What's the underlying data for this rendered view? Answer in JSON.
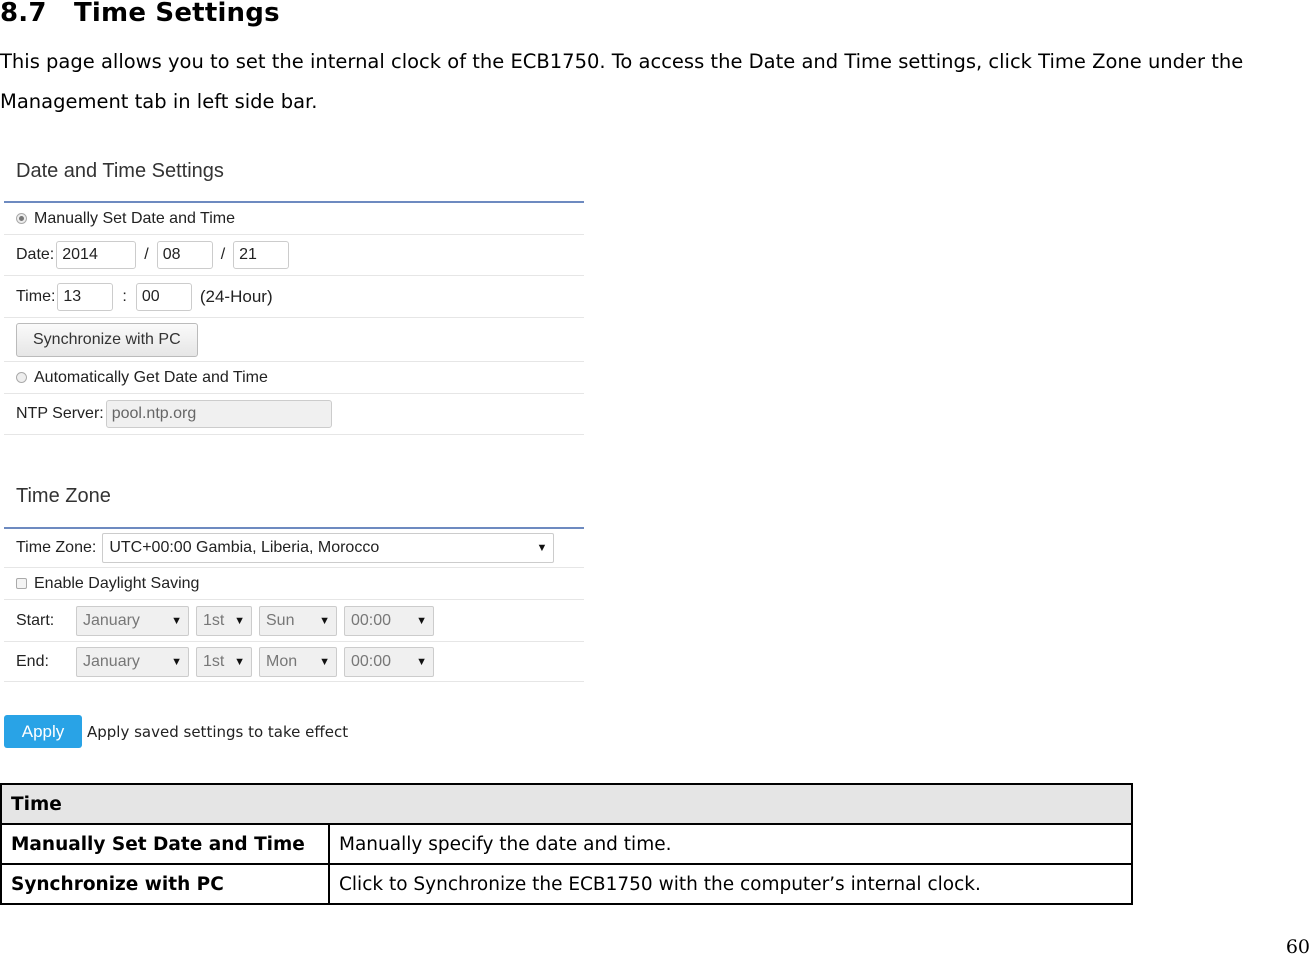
{
  "heading": {
    "number": "8.7",
    "title": "Time Settings"
  },
  "intro": "This page allows you to set the internal clock of the ECB1750. To access the Date and Time settings, click Time Zone under the Management tab in left side bar.",
  "screenshot": {
    "date_time_section": {
      "title": "Date and Time Settings",
      "manual_label": "Manually Set Date and Time",
      "manual_selected": true,
      "date_label": "Date:",
      "date_year": "2014",
      "date_month": "08",
      "date_day": "21",
      "date_sep": "/",
      "time_label": "Time:",
      "time_hour": "13",
      "time_minute": "00",
      "time_sep": ":",
      "time_format": "(24-Hour)",
      "sync_button": "Synchronize with PC",
      "auto_label": "Automatically Get Date and Time",
      "auto_selected": false,
      "ntp_label": "NTP Server:",
      "ntp_value": "pool.ntp.org"
    },
    "time_zone_section": {
      "title": "Time Zone",
      "tz_label": "Time Zone:",
      "tz_value": "UTC+00:00 Gambia, Liberia, Morocco",
      "dst_label": "Enable Daylight Saving",
      "dst_checked": false,
      "start_label": "Start:",
      "start": {
        "month": "January",
        "week": "1st",
        "day": "Sun",
        "time": "00:00"
      },
      "end_label": "End:",
      "end": {
        "month": "January",
        "week": "1st",
        "day": "Mon",
        "time": "00:00"
      }
    },
    "apply_button": "Apply",
    "apply_note": "Apply saved settings to take effect"
  },
  "table": {
    "header": "Time",
    "rows": [
      {
        "key": "Manually Set Date and Time",
        "value": "Manually specify the date and time."
      },
      {
        "key": "Synchronize with PC",
        "value": "Click to Synchronize the ECB1750 with the computer’s internal clock."
      }
    ]
  },
  "page_number": "60"
}
